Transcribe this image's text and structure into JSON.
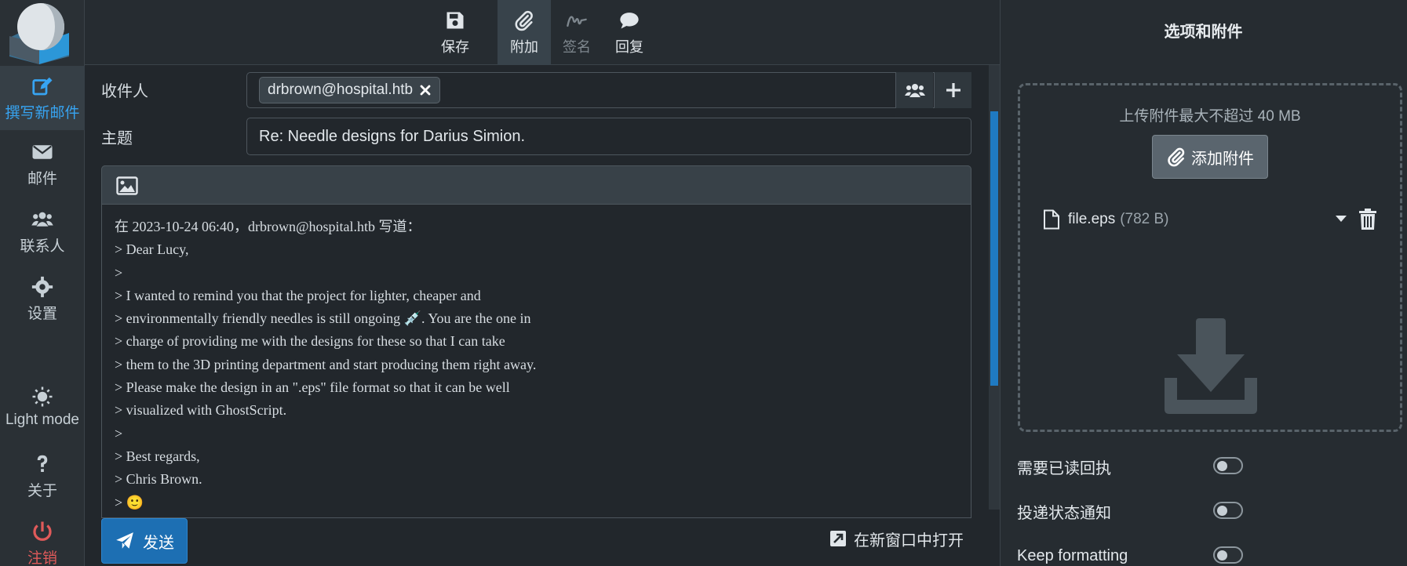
{
  "nav": {
    "compose": "撰写新邮件",
    "mail": "邮件",
    "contacts": "联系人",
    "settings": "设置",
    "light_mode": "Light mode",
    "about": "关于",
    "logout": "注销"
  },
  "toolbar": {
    "save": "保存",
    "attach": "附加",
    "signature": "签名",
    "responses": "回复"
  },
  "compose": {
    "recipient_label": "收件人",
    "recipient_chip": "drbrown@hospital.htb",
    "subject_label": "主题",
    "subject_value": "Re: Needle designs for Darius Simion.",
    "body_lines": [
      "在 2023-10-24 06:40，drbrown@hospital.htb 写道：",
      "> Dear Lucy,",
      ">",
      "> I wanted to remind you that the project for lighter, cheaper and",
      "> environmentally friendly needles is still ongoing 💉. You are the one in",
      "> charge of providing me with the designs for these so that I can take",
      "> them to the 3D printing department and start producing them right away.",
      "> Please make the design in an \".eps\" file format so that it can be well",
      "> visualized with GhostScript.",
      ">",
      "> Best regards,",
      "> Chris Brown.",
      "> 🙂"
    ],
    "send": "发送",
    "open_new_window": "在新窗口中打开"
  },
  "options_panel": {
    "title": "选项和附件",
    "upload_hint": "上传附件最大不超过 40 MB",
    "add_attachment": "添加附件",
    "attachment": {
      "name": "file.eps",
      "size": "(782 B)"
    },
    "options": [
      {
        "label": "需要已读回执",
        "enabled": false
      },
      {
        "label": "投递状态通知",
        "enabled": false
      },
      {
        "label": "Keep formatting",
        "enabled": false
      }
    ]
  },
  "colors": {
    "accent": "#37a4f2",
    "send_button": "#1d6fb3",
    "logout": "#e05a5a"
  }
}
